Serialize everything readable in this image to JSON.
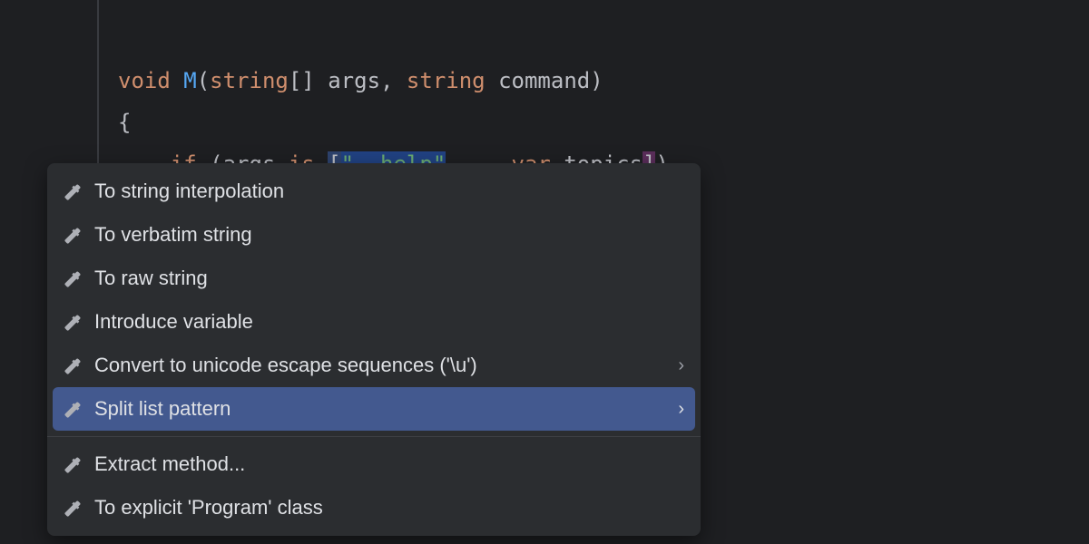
{
  "code": {
    "line1": {
      "kwVoid": "void",
      "method": "M",
      "open": "(",
      "typeArgs": "string",
      "brackets": "[]",
      "argsId": " args",
      "comma": ", ",
      "typeCmd": "string",
      "cmdId": " command",
      "close": ")"
    },
    "line2": {
      "brace": "{"
    },
    "line3": {
      "kwIf": "if",
      "open": " (",
      "argsRef": "args ",
      "kwIs": "is",
      "sp": " ",
      "lbr": "[",
      "str": "\"--help\"",
      "commaDots": ", .. ",
      "kwVar": "var",
      "topics": " topics",
      "rbr": "]",
      "close": ")"
    }
  },
  "menu": {
    "items": [
      {
        "label": "To string interpolation",
        "submenu": false,
        "selected": false
      },
      {
        "label": "To verbatim string",
        "submenu": false,
        "selected": false
      },
      {
        "label": "To raw string",
        "submenu": false,
        "selected": false
      },
      {
        "label": "Introduce variable",
        "submenu": false,
        "selected": false
      },
      {
        "label": "Convert to unicode escape sequences ('\\u')",
        "submenu": true,
        "selected": false
      },
      {
        "label": "Split list pattern",
        "submenu": true,
        "selected": true
      }
    ],
    "items2": [
      {
        "label": "Extract method...",
        "submenu": false,
        "selected": false
      },
      {
        "label": "To explicit 'Program' class",
        "submenu": false,
        "selected": false
      }
    ]
  },
  "symbols": {
    "chevron": "›"
  }
}
